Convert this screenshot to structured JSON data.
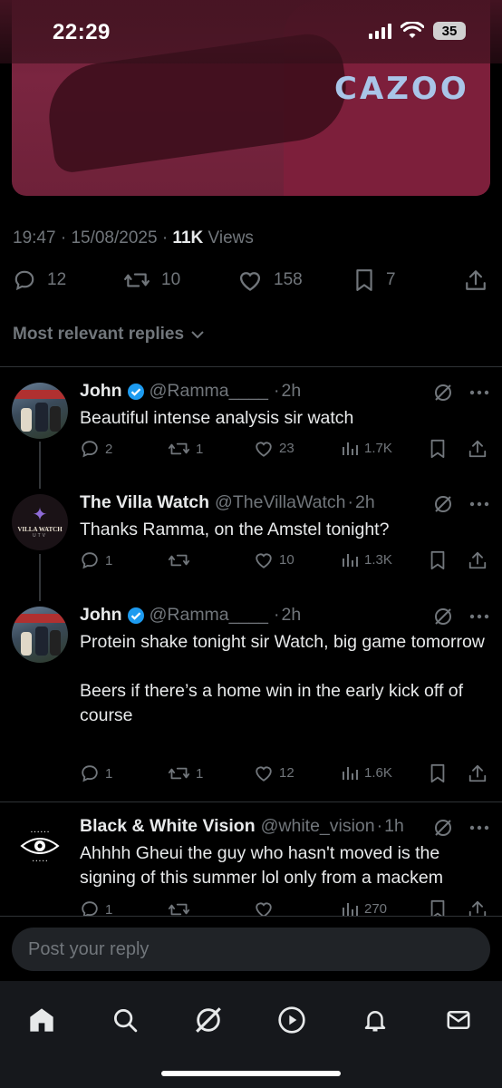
{
  "status_bar": {
    "time": "22:29",
    "battery": "35"
  },
  "media": {
    "sponsor_text": "CAZOO"
  },
  "post": {
    "time": "19:47",
    "date": "15/08/2025",
    "views_count": "11K",
    "views_label": "Views",
    "separator": "·",
    "replies": "12",
    "reposts": "10",
    "likes": "158",
    "bookmarks": "7"
  },
  "replies_filter": {
    "label": "Most relevant replies"
  },
  "replies": [
    {
      "name": "John",
      "verified": true,
      "handle": "@Ramma____",
      "time": "2h",
      "text": "Beautiful intense analysis sir watch",
      "replies": "2",
      "reposts": "1",
      "likes": "23",
      "views": "1.7K"
    },
    {
      "name": "The Villa Watch",
      "verified": false,
      "handle": "@TheVillaWatch",
      "time": "2h",
      "text": "Thanks Ramma, on the Amstel tonight?",
      "avatar_text": "VILLA WATCH",
      "avatar_subtext": "UTV",
      "replies": "1",
      "reposts": "",
      "likes": "10",
      "views": "1.3K"
    },
    {
      "name": "John",
      "verified": true,
      "handle": "@Ramma____",
      "time": "2h",
      "text_line1": "Protein shake tonight sir Watch, big game tomorrow",
      "text_line2": "Beers if there’s a home win in the early kick off of course",
      "replies": "1",
      "reposts": "1",
      "likes": "12",
      "views": "1.6K"
    },
    {
      "name": "Black & White Vision",
      "verified": false,
      "handle": "@white_vision",
      "time": "1h",
      "text": "Ahhhh Gheui the guy who hasn't moved is the signing of this summer lol only from a mackem",
      "replies": "1",
      "reposts": "",
      "likes": "",
      "views": "270"
    }
  ],
  "reply_box": {
    "placeholder": "Post your reply"
  },
  "tabs": [
    "home",
    "search",
    "grok",
    "video",
    "notifications",
    "messages"
  ]
}
